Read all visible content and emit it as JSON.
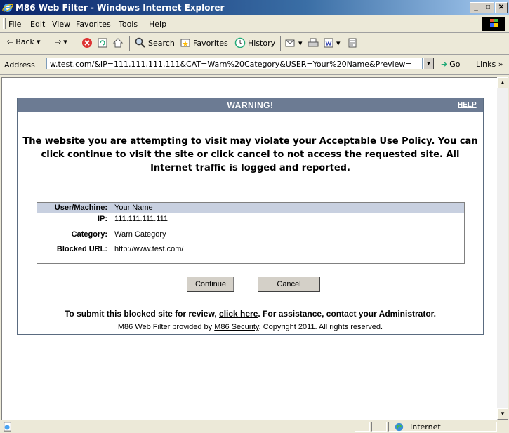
{
  "window": {
    "title": "M86 Web Filter - Windows Internet Explorer"
  },
  "menu": [
    "File",
    "Edit",
    "View",
    "Favorites",
    "Tools",
    "Help"
  ],
  "toolbar": {
    "back": "Back",
    "search": "Search",
    "favorites": "Favorites",
    "history": "History"
  },
  "address": {
    "label": "Address",
    "url": "w.test.com/&IP=111.111.111.111&CAT=Warn%20Category&USER=Your%20Name&Preview=",
    "go": "Go",
    "links": "Links »"
  },
  "page": {
    "header_title": "WARNING!",
    "help_link": "HELP",
    "message": "The website you are attempting to visit may violate your Acceptable Use Policy. You can click continue to visit the site or click cancel to not access the requested site. All Internet traffic is logged and reported.",
    "info": {
      "user_label": "User/Machine:",
      "user_value": "Your Name",
      "ip_label": "IP:",
      "ip_value": "111.111.111.111",
      "category_label": "Category:",
      "category_value": "Warn Category",
      "url_label": "Blocked URL:",
      "url_value": "http://www.test.com/"
    },
    "continue_button": "Continue",
    "cancel_button": "Cancel",
    "submit_text_1": "To submit this blocked site for review, ",
    "submit_link": "click here",
    "submit_text_2": ". For assistance, contact your Administrator.",
    "footer_text_1": "M86 Web Filter provided by ",
    "footer_link": "M86 Security",
    "footer_text_2": ". Copyright 2011. All rights reserved."
  },
  "status": {
    "zone": "Internet"
  },
  "colors": {
    "header_bg": "#6c7b93",
    "info_header_bg": "#c8d0e0",
    "titlebar": "#0a246a"
  }
}
